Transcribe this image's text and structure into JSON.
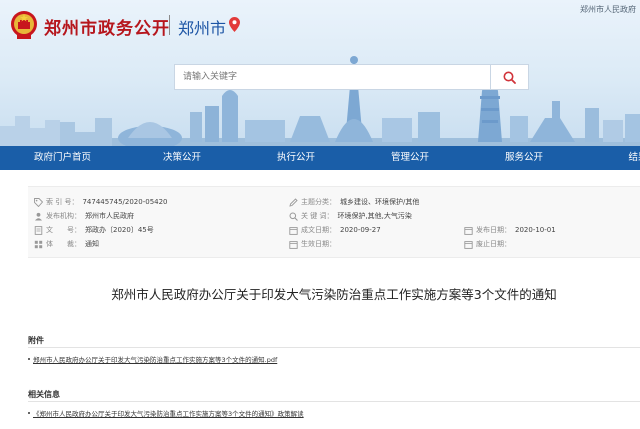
{
  "header": {
    "site_title": "郑州市政务公开",
    "city": "郑州市",
    "top_link": "郑州市人民政府",
    "search_placeholder": "请输入关键字"
  },
  "nav": {
    "items": [
      "政府门户首页",
      "决策公开",
      "执行公开",
      "管理公开",
      "服务公开",
      "结果"
    ]
  },
  "meta": {
    "index_no_label": "索 引 号：",
    "index_no": "747445745/2020-05420",
    "topic_label": "主题分类：",
    "topic": "城乡建设、环境保护/其他",
    "issuer_label": "发布机构：",
    "issuer": "郑州市人民政府",
    "keywords_label": "关 键 词：",
    "keywords": "环境保护,其他,大气污染",
    "docno_label": "文　　号：",
    "docno": "郑政办〔2020〕45号",
    "date_made_label": "成文日期：",
    "date_made": "2020-09-27",
    "date_pub_label": "发布日期：",
    "date_pub": "2020-10-01",
    "genre_label": "体　　裁：",
    "genre": "通知",
    "effective_label": "生效日期：",
    "effective": "",
    "abolish_label": "废止日期：",
    "abolish": ""
  },
  "article": {
    "title": "郑州市人民政府办公厅关于印发大气污染防治重点工作实施方案等3个文件的通知"
  },
  "attachments": {
    "heading": "附件",
    "items": [
      "郑州市人民政府办公厅关于印发大气污染防治重点工作实施方案等3个文件的通知.pdf"
    ]
  },
  "related": {
    "heading": "相关信息",
    "items": [
      "《郑州市人民政府办公厅关于印发大气污染防治重点工作实施方案等3个文件的通知》政策解读"
    ]
  },
  "colors": {
    "brand_red": "#b6161d",
    "nav_blue": "#1a5ea8",
    "city_blue": "#1d55a5"
  }
}
